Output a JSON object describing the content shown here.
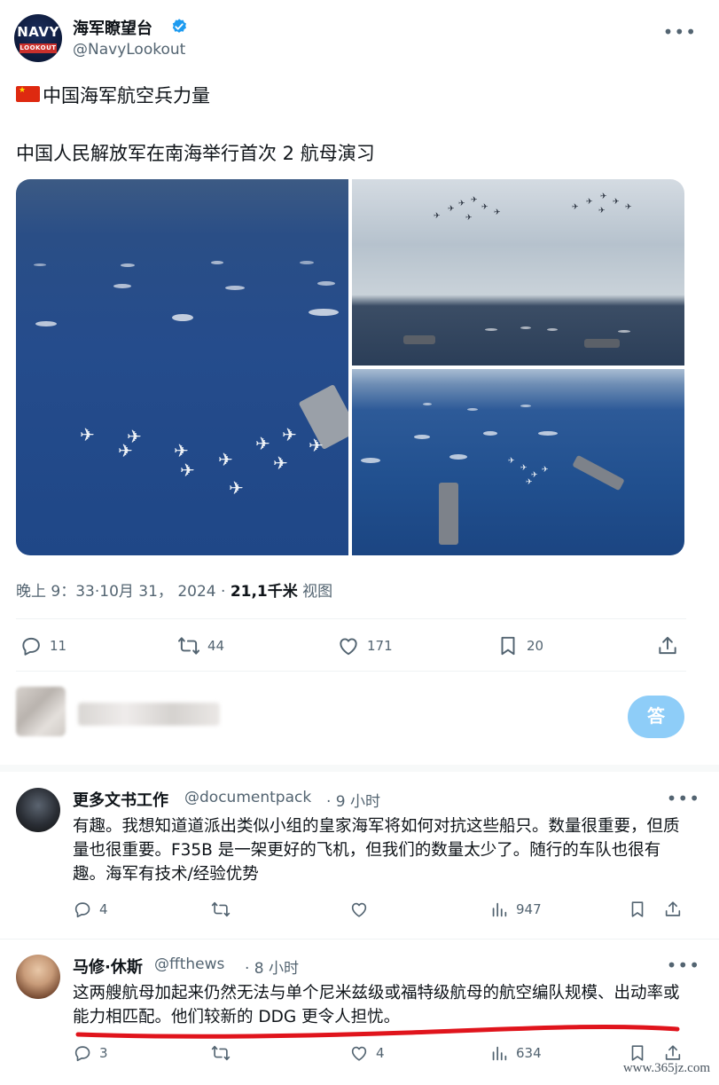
{
  "post": {
    "author_name": "海军瞭望台",
    "author_handle": "@NavyLookout",
    "avatar_word": "NAVY",
    "avatar_band": "LOOKOUT",
    "flag_icon": "china-flag-icon",
    "line1": "中国海军航空兵力量",
    "line2": "中国人民解放军在南海举行首次 2 航母演习",
    "timestamp": "晚上 9：33·10月 31， 2024 · ",
    "views_count": "21,1千米",
    "views_label": " 视图"
  },
  "stats": {
    "replies": "11",
    "reposts": "44",
    "likes": "171",
    "bookmarks": "20"
  },
  "composer": {
    "reply_button": "答"
  },
  "replies": [
    {
      "name": "更多文书工作",
      "handle": "@documentpack",
      "time": "· 9 小时",
      "text": "有趣。我想知道道派出类似小组的皇家海军将如何对抗这些船只。数量很重要，但质量也很重要。F35B 是一架更好的飞机，但我们的数量太少了。随行的车队也很有趣。海军有技术/经验优势",
      "stats": {
        "replies": "4",
        "reposts": "",
        "likes": "",
        "views": "947"
      }
    },
    {
      "name": "马修·休斯",
      "handle": "@ffthews",
      "time": "· 8 小时",
      "text": "这两艘航母加起来仍然无法与单个尼米兹级或福特级航母的航空编队规模、出动率或能力相匹配。他们较新的 DDG 更令人担忧。",
      "stats": {
        "replies": "3",
        "reposts": "",
        "likes": "4",
        "views": "634"
      }
    }
  ],
  "watermark": "www.365jz.com",
  "colors": {
    "text": "#0f1419",
    "muted": "#536471",
    "accent": "#1d9bf0",
    "reply_button": "#8ecdf8",
    "underline": "#e0141c"
  }
}
